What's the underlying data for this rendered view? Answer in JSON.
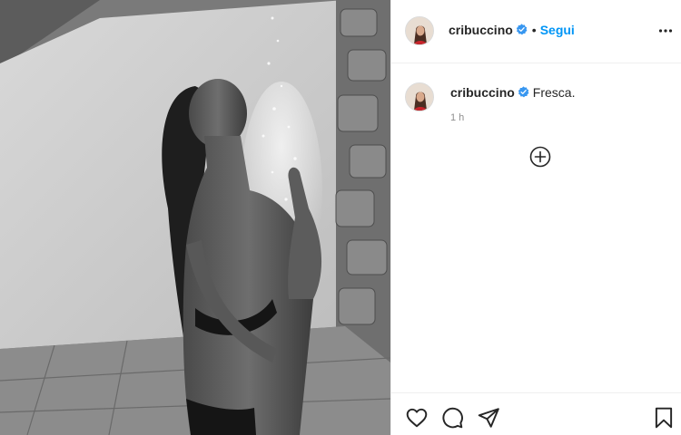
{
  "post": {
    "username": "cribuccino",
    "verified": true,
    "separator": "•",
    "follow_label": "Segui",
    "caption_text": "Fresca.",
    "timestamp": "1 h"
  },
  "icons": {
    "more": "more-horizontal-icon",
    "verified": "verified-badge-icon",
    "load_more": "plus-circle-icon",
    "like": "heart-icon",
    "comment": "comment-bubble-icon",
    "share": "paper-plane-icon",
    "save": "bookmark-icon"
  },
  "colors": {
    "accent": "#0095f6",
    "text": "#262626",
    "muted": "#8e8e8e",
    "border": "#efefef"
  }
}
